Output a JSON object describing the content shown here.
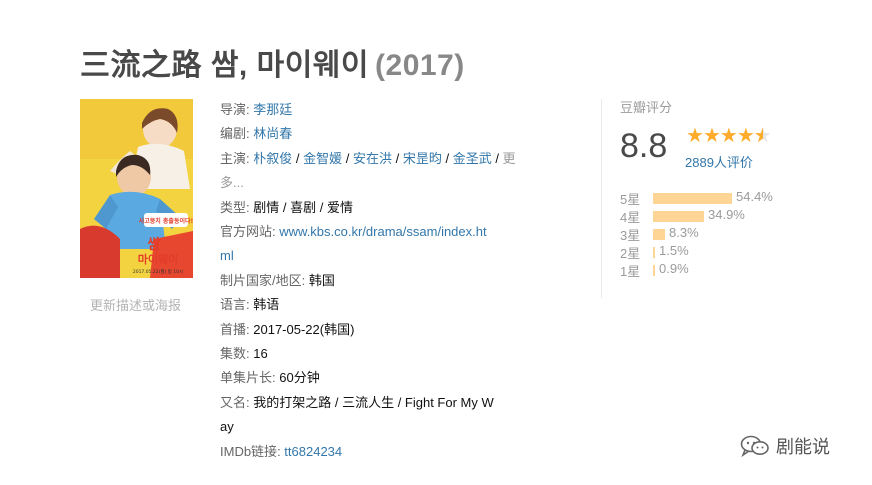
{
  "header": {
    "title": "三流之路 쌈, 마이웨이",
    "year": "(2017)"
  },
  "poster": {
    "alt_link": "更新描述或海报",
    "tagline": "사고뭉치 총출동이다!",
    "title_korean_line1": "쌈",
    "title_korean_line2": "마이웨이",
    "date_text": "2017.05.22(월) 밤 10시"
  },
  "info": {
    "director_label": "导演",
    "director": "李那廷",
    "writer_label": "编剧",
    "writer": "林尚春",
    "cast_label": "主演",
    "cast": [
      "朴叙俊",
      "金智媛",
      "安在洪",
      "宋昰昀",
      "金圣武"
    ],
    "cast_more": "更多...",
    "genre_label": "类型",
    "genres": [
      "剧情",
      "喜剧",
      "爱情"
    ],
    "site_label": "官方网站",
    "site_line1": "www.kbs.co.kr/drama/ssam/index.ht",
    "site_line2": "ml",
    "country_label": "制片国家/地区",
    "country": "韩国",
    "language_label": "语言",
    "language": "韩语",
    "premiere_label": "首播",
    "premiere": "2017-05-22(韩国)",
    "episodes_label": "集数",
    "episodes": "16",
    "runtime_label": "单集片长",
    "runtime": "60分钟",
    "aka_label": "又名",
    "aka_line1": "我的打架之路 / 三流人生 / Fight For My W",
    "aka_line2": "ay",
    "imdb_label": "IMDb链接",
    "imdb": "tt6824234"
  },
  "rating": {
    "label": "豆瓣评分",
    "score": "8.8",
    "stars_value": 4.5,
    "votes": "2889人评价",
    "breakdown": [
      {
        "label": "5星",
        "percent": 54.4,
        "text": "54.4%"
      },
      {
        "label": "4星",
        "percent": 34.9,
        "text": "34.9%"
      },
      {
        "label": "3星",
        "percent": 8.3,
        "text": "8.3%"
      },
      {
        "label": "2星",
        "percent": 1.5,
        "text": "1.5%"
      },
      {
        "label": "1星",
        "percent": 0.9,
        "text": "0.9%"
      }
    ]
  },
  "watermark": {
    "text": "剧能说",
    "icon": "wechat-icon"
  },
  "colors": {
    "link": "#3377aa",
    "star": "#ffac2d",
    "bar": "#ffd596",
    "label": "#666666"
  }
}
